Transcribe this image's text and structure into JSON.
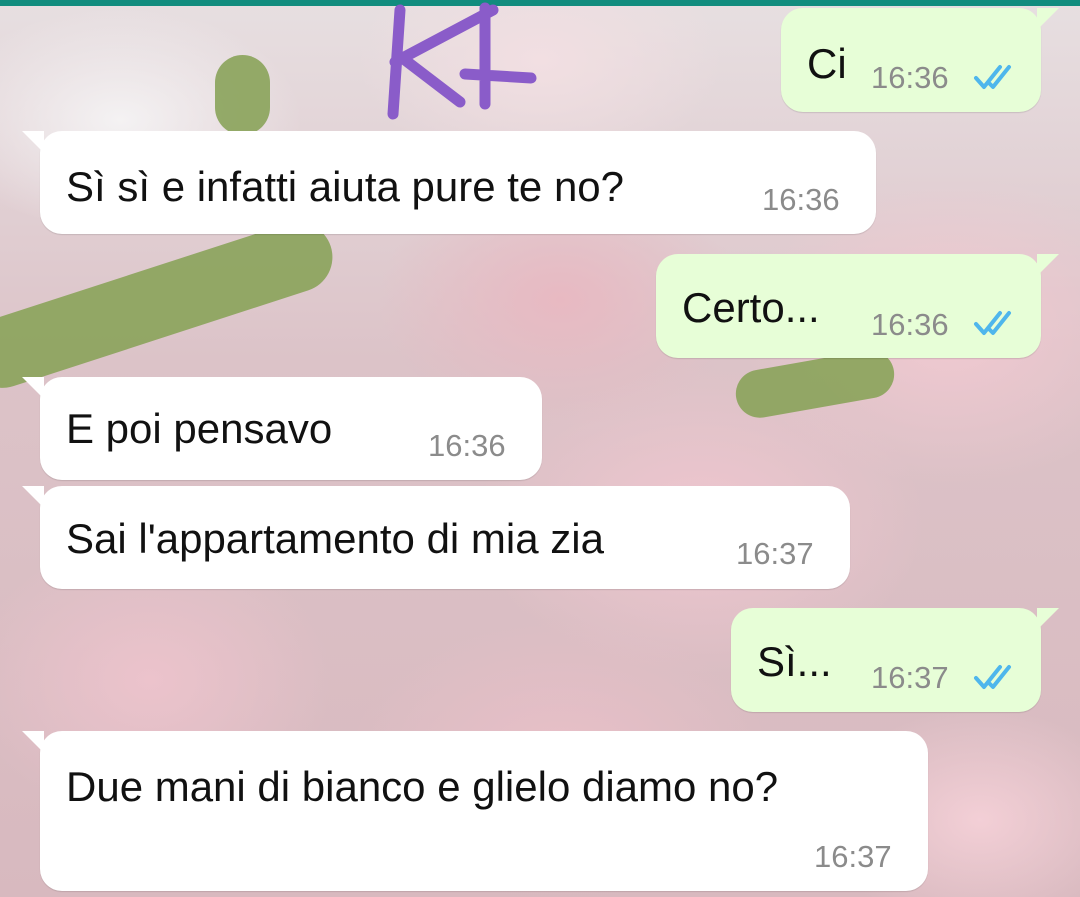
{
  "colors": {
    "header_accent": "#128c7e",
    "incoming_bubble": "#ffffff",
    "outgoing_bubble": "#e7fed7",
    "read_ticks": "#4fb6ec",
    "timestamp": "#8b8b8b",
    "scribble": "#8a5cc9"
  },
  "messages": [
    {
      "direction": "outgoing",
      "text": "Ci",
      "time": "16:36",
      "status": "read",
      "status_icon": "double-check-icon"
    },
    {
      "direction": "incoming",
      "text": "Sì sì e infatti aiuta pure te no?",
      "time": "16:36"
    },
    {
      "direction": "outgoing",
      "text": "Certo...",
      "time": "16:36",
      "status": "read",
      "status_icon": "double-check-icon"
    },
    {
      "direction": "incoming",
      "text": "E poi pensavo",
      "time": "16:36"
    },
    {
      "direction": "incoming",
      "text": "Sai l'appartamento di mia zia",
      "time": "16:37"
    },
    {
      "direction": "outgoing",
      "text": "Sì...",
      "time": "16:37",
      "status": "read",
      "status_icon": "double-check-icon"
    },
    {
      "direction": "incoming",
      "text": "Due mani di bianco e glielo diamo no?",
      "time": "16:37"
    }
  ]
}
